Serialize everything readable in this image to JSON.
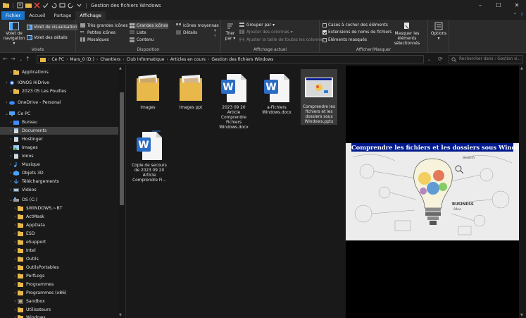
{
  "window": {
    "title": "Gestion des fichiers Windows",
    "controls": {
      "minimize": "–",
      "maximize": "☐",
      "close": "✕"
    }
  },
  "tabs": [
    {
      "label": "Fichier"
    },
    {
      "label": "Accueil"
    },
    {
      "label": "Partage"
    },
    {
      "label": "Affichage"
    }
  ],
  "ribbon": {
    "volets": {
      "nav_pane": "Volet de navigation",
      "preview_pane": "Volet de visualisation",
      "details_pane": "Volet des détails",
      "label": "Volets"
    },
    "disposition": {
      "items": [
        "Très grandes icônes",
        "Grandes icônes",
        "Icônes moyennes",
        "Petites icônes",
        "Liste",
        "Détails",
        "Mosaïques",
        "Contenu"
      ],
      "label": "Disposition"
    },
    "affichage_actuel": {
      "sort": "Trier par",
      "group": "Grouper par",
      "add_columns": "Ajouter des colonnes",
      "fit_columns": "Ajuster la taille de toutes les colonnes",
      "label": "Affichage actuel"
    },
    "afficher_masquer": {
      "checkboxes": [
        {
          "label": "Cases à cocher des éléments",
          "checked": false
        },
        {
          "label": "Extensions de noms de fichiers",
          "checked": true
        },
        {
          "label": "Éléments masqués",
          "checked": false
        }
      ],
      "hide_selected": "Masquer les éléments sélectionnés",
      "label": "Afficher/Masquer"
    },
    "options": {
      "label": "Options"
    }
  },
  "address": {
    "crumbs": [
      "Ce PC",
      "Mars_0 (D:)",
      "Chantiers",
      "Club Informatique",
      "Articles en cours",
      "Gestion des fichiers Windows"
    ],
    "search_placeholder": "Rechercher dans : Gestion d..."
  },
  "sidebar": {
    "items": [
      {
        "label": "Applications",
        "icon": "folder",
        "indent": 1,
        "chev": "›"
      },
      {
        "label": "IONOS HiDrive",
        "icon": "cloud-blue",
        "indent": 0,
        "chev": "›"
      },
      {
        "label": "2023 05 Les Pouilles",
        "icon": "folder",
        "indent": 1,
        "chev": "›"
      },
      {
        "label": "OneDrive - Personal",
        "icon": "cloud",
        "indent": 0,
        "chev": "›"
      },
      {
        "label": "Ce PC",
        "icon": "pc",
        "indent": 0,
        "chev": "⌄"
      },
      {
        "label": "Bureau",
        "icon": "folder-blue",
        "indent": 1,
        "chev": "›"
      },
      {
        "label": "Documents",
        "icon": "doc",
        "indent": 1,
        "chev": "›",
        "selected": true
      },
      {
        "label": "Hostinger",
        "icon": "doc",
        "indent": 1,
        "chev": "›"
      },
      {
        "label": "Images",
        "icon": "pic",
        "indent": 1,
        "chev": "›"
      },
      {
        "label": "Ionos",
        "icon": "doc",
        "indent": 1,
        "chev": "›"
      },
      {
        "label": "Musique",
        "icon": "music",
        "indent": 1,
        "chev": "›"
      },
      {
        "label": "Objets 3D",
        "icon": "3d",
        "indent": 1,
        "chev": "›"
      },
      {
        "label": "Téléchargements",
        "icon": "download",
        "indent": 1,
        "chev": "›"
      },
      {
        "label": "Vidéos",
        "icon": "video",
        "indent": 1,
        "chev": "›"
      },
      {
        "label": "OS (C:)",
        "icon": "drive",
        "indent": 1,
        "chev": "⌄"
      },
      {
        "label": "$WINDOWS.~BT",
        "icon": "folder",
        "indent": 2,
        "chev": "›"
      },
      {
        "label": "ActMask",
        "icon": "folder",
        "indent": 2,
        "chev": "›"
      },
      {
        "label": "AppData",
        "icon": "folder",
        "indent": 2,
        "chev": "›"
      },
      {
        "label": "ESD",
        "icon": "folder",
        "indent": 2,
        "chev": "›"
      },
      {
        "label": "eSupport",
        "icon": "folder",
        "indent": 2,
        "chev": "›"
      },
      {
        "label": "Intel",
        "icon": "folder",
        "indent": 2,
        "chev": "›"
      },
      {
        "label": "Outils",
        "icon": "folder",
        "indent": 2,
        "chev": "›"
      },
      {
        "label": "OutilsPortables",
        "icon": "folder",
        "indent": 2,
        "chev": "›"
      },
      {
        "label": "PerfLogs",
        "icon": "folder",
        "indent": 2,
        "chev": "›"
      },
      {
        "label": "Programmes",
        "icon": "folder",
        "indent": 2,
        "chev": "›"
      },
      {
        "label": "Programmes (x86)",
        "icon": "folder",
        "indent": 2,
        "chev": "›"
      },
      {
        "label": "Sandbox",
        "icon": "sandbox",
        "indent": 2,
        "chev": "›"
      },
      {
        "label": "Utilisateurs",
        "icon": "folder",
        "indent": 2,
        "chev": "›"
      },
      {
        "label": "Windows",
        "icon": "folder",
        "indent": 2,
        "chev": "›"
      }
    ]
  },
  "files": [
    {
      "name": "Images",
      "type": "folder"
    },
    {
      "name": "Images ppt",
      "type": "folder"
    },
    {
      "name": "2023 09 20 Article Comprendre Fichiers Windows.docx",
      "type": "word"
    },
    {
      "name": "a-Fichiers Windows.docx",
      "type": "word"
    },
    {
      "name": "Comprendre les fichiers et les dossiers sous Windows.pptx",
      "type": "pptx",
      "selected": true
    },
    {
      "name": "Copie de secours de 2023 09 20 Article Comprendre Fi...",
      "type": "word"
    }
  ],
  "preview": {
    "slide_title": "Comprendre les fichiers et les dossiers sous Windows",
    "slide_words": [
      "BUSINESS",
      "Idea",
      "Search"
    ]
  },
  "colors": {
    "accent": "#1a73c9",
    "folder": "#e8b84a",
    "word": "#2b6cc4",
    "slide_title_bg": "#001a8c"
  }
}
